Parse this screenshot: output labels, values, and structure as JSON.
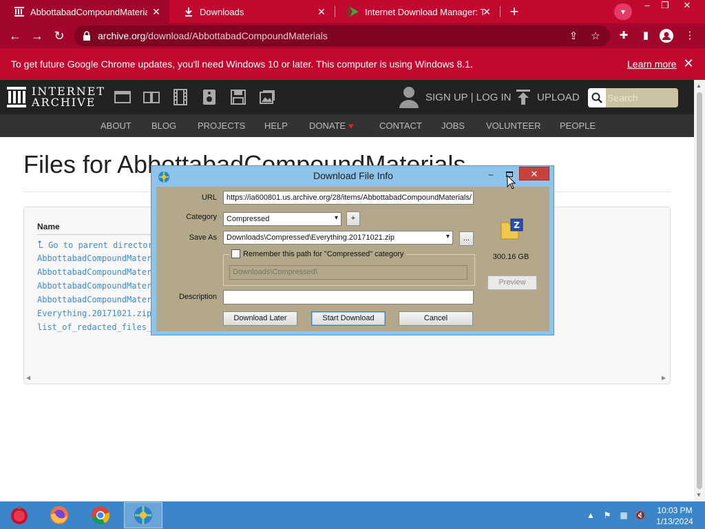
{
  "browser": {
    "tabs": [
      {
        "title": "AbbottabadCompoundMaterials"
      },
      {
        "title": "Downloads"
      },
      {
        "title": "Internet Download Manager: The"
      }
    ],
    "address": {
      "host": "archive.org",
      "path": "/download/AbbottabadCompoundMaterials"
    },
    "infobar": {
      "message": "To get future Google Chrome updates, you'll need Windows 10 or later. This computer is using Windows 8.1.",
      "link": "Learn more"
    },
    "colors": {
      "frame": "#c2082f",
      "active_tab": "#a2062a"
    }
  },
  "archive": {
    "logo_line1": "INTERNET",
    "logo_line2": "ARCHIVE",
    "signup": "SIGN UP | LOG IN",
    "upload": "UPLOAD",
    "search_placeholder": "Search",
    "nav": [
      "ABOUT",
      "BLOG",
      "PROJECTS",
      "HELP",
      "DONATE",
      "CONTACT",
      "JOBS",
      "VOLUNTEER",
      "PEOPLE"
    ],
    "donate_heart": "♥"
  },
  "page": {
    "title": "Files for AbbottabadCompoundMaterials",
    "column_name": "Name",
    "parent_link": "Go to parent directory",
    "files": [
      "AbbottabadCompoundMaterials_archive.torrent",
      "AbbottabadCompoundMaterials_files.xml",
      "AbbottabadCompoundMaterials_meta.sqlite",
      "AbbottabadCompoundMaterials_meta.xml",
      "Everything.20171021.zip",
      "list_of_redacted_files_and_folders.txt"
    ]
  },
  "dialog": {
    "title": "Download File Info",
    "labels": {
      "url": "URL",
      "category": "Category",
      "save_as": "Save As",
      "description": "Description"
    },
    "url": "https://ia600801.us.archive.org/28/items/AbbottabadCompoundMaterials/",
    "category": "Compressed",
    "save_as": "Downloads\\Compressed\\Everything.20171021.zip",
    "remember_label": "Remember this path for \"Compressed\" category",
    "remember_path": "Downloads\\Compressed\\",
    "description": "",
    "size": "300.16  GB",
    "buttons": {
      "add_category": "+",
      "browse": "...",
      "preview": "Preview",
      "download_later": "Download Later",
      "start_download": "Start Download",
      "cancel": "Cancel"
    }
  },
  "taskbar": {
    "time": "10:03 PM",
    "date": "1/13/2024",
    "color": "#3a86c8"
  }
}
